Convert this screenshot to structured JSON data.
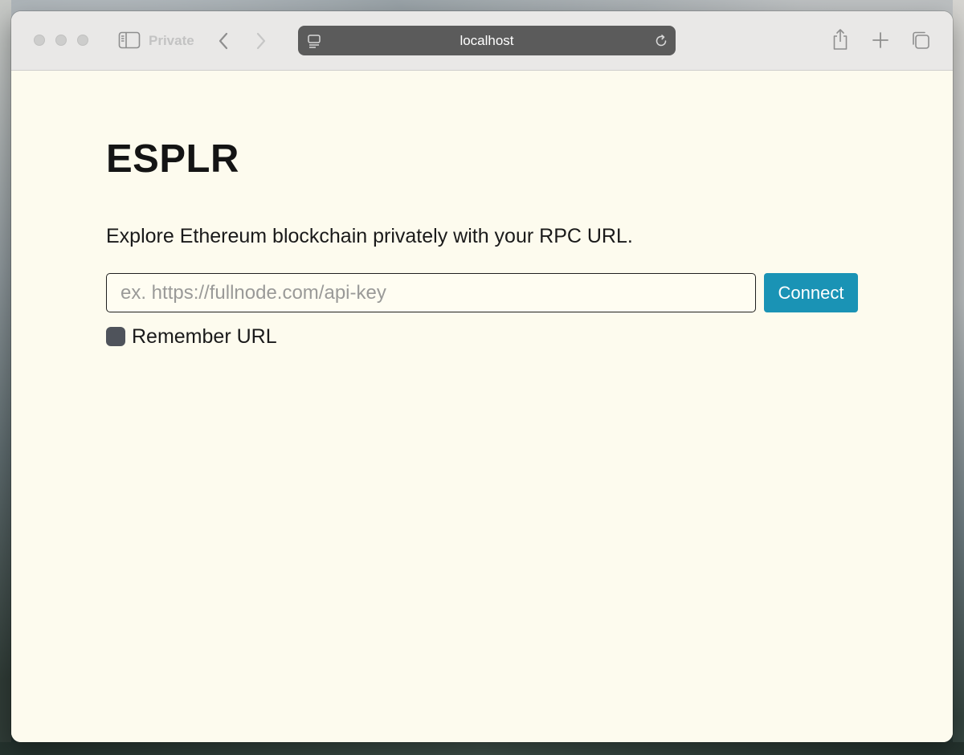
{
  "browser": {
    "private_label": "Private",
    "address": "localhost",
    "colors": {
      "toolbar": "#e9e8e7",
      "address_bar": "#5b5b5b"
    },
    "icons": [
      "sidebar-icon",
      "chevron-left-icon",
      "chevron-right-icon",
      "page-menu-icon",
      "reload-icon",
      "share-icon",
      "plus-icon",
      "tabs-overview-icon"
    ]
  },
  "page": {
    "title": "ESPLR",
    "tagline": "Explore Ethereum blockchain privately with your RPC URL.",
    "rpc_input": {
      "placeholder": "ex. https://fullnode.com/api-key",
      "value": ""
    },
    "connect_label": "Connect",
    "remember_label": "Remember URL",
    "remember_checked": false,
    "colors": {
      "background": "#fdfbee",
      "button": "#1a93b5",
      "checkbox": "#4f535b"
    }
  }
}
